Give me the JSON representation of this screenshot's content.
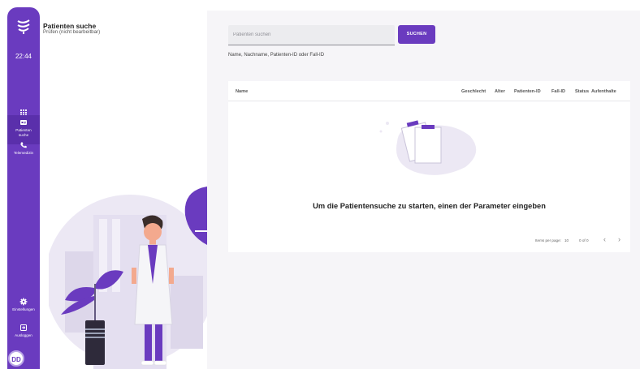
{
  "sidebar": {
    "time": "22:44",
    "items": [
      {
        "label": "Alle Patienten",
        "icon": "grid-icon"
      },
      {
        "label": "Patienten suche",
        "icon": "id-card-icon"
      },
      {
        "label": "Telemedizin",
        "icon": "phone-icon"
      }
    ],
    "bottom_items": [
      {
        "label": "Einstellungen",
        "icon": "gear-icon"
      },
      {
        "label": "Ausloggen",
        "icon": "logout-icon"
      }
    ],
    "avatar_initials": "DD",
    "accent_color": "#6a3bbf"
  },
  "header": {
    "title": "Patienten suche",
    "subtitle": "Prüfen (nicht bearbeitbar)"
  },
  "search": {
    "placeholder": "Patienten suchen",
    "value": "",
    "button_label": "SUCHEN",
    "hint": "Name, Nachname, Patienten-ID oder Fall-ID"
  },
  "table": {
    "columns": [
      "Name",
      "Geschlecht",
      "Alter",
      "Patienten-ID",
      "Fall-ID",
      "Status",
      "Aufenthalte"
    ],
    "empty_message": "Um die Patientensuche zu starten, einen der Parameter eingeben"
  },
  "paginator": {
    "items_per_page_label": "Items per page:",
    "items_per_page": "10",
    "range": "0 of 0"
  }
}
